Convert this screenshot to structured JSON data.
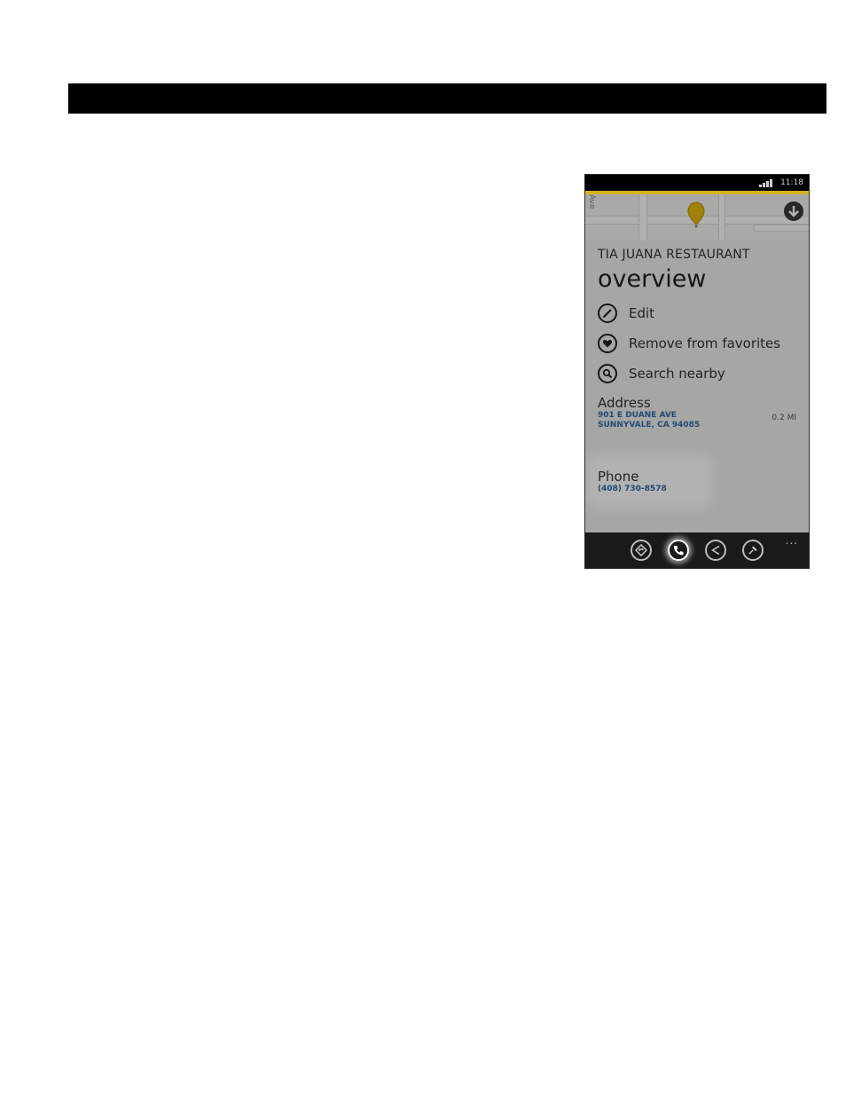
{
  "status_bar": {
    "time": "11:18"
  },
  "place": {
    "name": "TIA JUANA RESTAURANT",
    "page_title": "overview"
  },
  "actions": [
    {
      "label": "Edit",
      "icon": "pencil-icon"
    },
    {
      "label": "Remove from favorites",
      "icon": "heart-icon"
    },
    {
      "label": "Search nearby",
      "icon": "search-icon"
    }
  ],
  "address": {
    "label": "Address",
    "line1": "901 E DUANE AVE",
    "line2": "SUNNYVALE, CA 94085",
    "distance": "0.2 MI"
  },
  "phone": {
    "label": "Phone",
    "number": "(408) 730-8578"
  },
  "map": {
    "street_label": "Ave"
  },
  "app_bar": {
    "buttons": [
      "directions-icon",
      "call-icon",
      "share-icon",
      "pin-icon"
    ],
    "more": "..."
  },
  "colors": {
    "accent": "#d4b21a",
    "link": "#2f6da8",
    "top_bar": "#000000"
  }
}
